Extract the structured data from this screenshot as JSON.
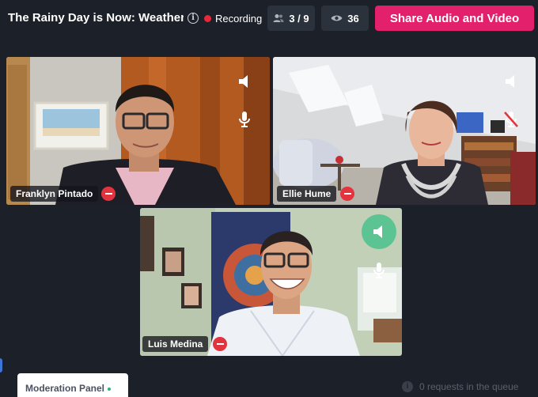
{
  "header": {
    "title": "The Rainy Day is Now: Weatheri...",
    "recording_label": "Recording",
    "participants_count": "3 / 9",
    "viewers_count": "36",
    "share_button_label": "Share Audio and Video"
  },
  "participants": [
    {
      "name": "Franklyn Pintado",
      "muted": false,
      "speaking": false
    },
    {
      "name": "Ellie Hume",
      "muted": true,
      "speaking": false
    },
    {
      "name": "Luis Medina",
      "muted": false,
      "speaking": true
    }
  ],
  "footer": {
    "moderation_panel_label": "Moderation Panel",
    "queue_text": "0 requests in the queue"
  },
  "colors": {
    "background": "#1c2028",
    "share_button": "#e3206c",
    "recording_dot": "#e8283a",
    "active_speaker": "#5cc393",
    "remove_button": "#e2343f"
  },
  "icons": [
    "info-icon",
    "recording-dot-icon",
    "participants-icon",
    "eye-icon",
    "speaker-icon",
    "mic-icon",
    "mic-off-icon",
    "minus-icon"
  ]
}
